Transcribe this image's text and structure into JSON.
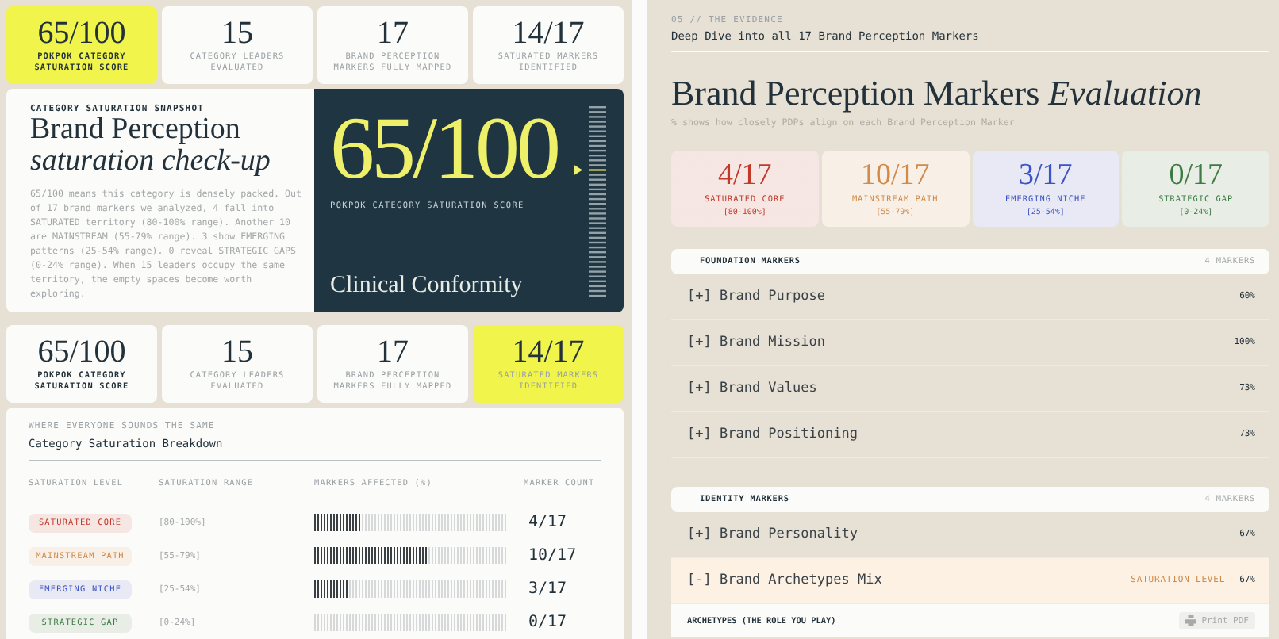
{
  "stats_top": [
    {
      "value": "65/100",
      "label": "POKPOK CATEGORY SATURATION SCORE",
      "highlighted": true,
      "emphasized": true
    },
    {
      "value": "15",
      "label": "CATEGORY LEADERS EVALUATED",
      "highlighted": false,
      "emphasized": false
    },
    {
      "value": "17",
      "label": "BRAND PERCEPTION MARKERS FULLY MAPPED",
      "highlighted": false,
      "emphasized": false
    },
    {
      "value": "14/17",
      "label": "SATURATED MARKERS IDENTIFIED",
      "highlighted": false,
      "emphasized": false
    }
  ],
  "snapshot": {
    "eyebrow": "CATEGORY SATURATION SNAPSHOT",
    "title": "Brand Perception",
    "title_italic": "saturation check-up",
    "body": "65/100 means this category is densely packed. Out of 17 brand markers we analyzed, 4 fall into SATURATED territory (80-100% range). Another 10 are MAINSTREAM (55-79% range). 3 show EMERGING patterns (25-54% range). 0 reveal STRATEGIC GAPS (0-24% range). When 15 leaders occupy the same territory, the empty spaces become worth exploring.",
    "score": "65/100",
    "score_label": "POKPOK CATEGORY SATURATION SCORE",
    "verdict": "Clinical Conformity"
  },
  "stats_bottom": [
    {
      "value": "65/100",
      "label": "POKPOK CATEGORY SATURATION SCORE",
      "highlighted": false,
      "emphasized": true
    },
    {
      "value": "15",
      "label": "CATEGORY LEADERS EVALUATED",
      "highlighted": false,
      "emphasized": false
    },
    {
      "value": "17",
      "label": "BRAND PERCEPTION MARKERS FULLY MAPPED",
      "highlighted": false,
      "emphasized": false
    },
    {
      "value": "14/17",
      "label": "SATURATED MARKERS IDENTIFIED",
      "highlighted": true,
      "emphasized": false
    }
  ],
  "breakdown": {
    "eyebrow": "WHERE EVERYONE SOUNDS THE SAME",
    "title": "Category Saturation Breakdown",
    "columns": [
      "SATURATION LEVEL",
      "SATURATION RANGE",
      "MARKERS AFFECTED (%)",
      "MARKER COUNT"
    ],
    "rows": [
      {
        "level_name": "SATURATED CORE",
        "range": "[80-100%]",
        "level": 0.235,
        "count": "4/17",
        "color": "#c0392b"
      },
      {
        "level_name": "MAINSTREAM PATH",
        "range": "[55-79%]",
        "level": 0.588,
        "count": "10/17",
        "color": "#d08a4a"
      },
      {
        "level_name": "EMERGING NICHE",
        "range": "[25-54%]",
        "level": 0.176,
        "count": "3/17",
        "color": "#3d52c4"
      },
      {
        "level_name": "STRATEGIC GAP",
        "range": "[0-24%]",
        "count": "0/17",
        "color": "#3e7a44"
      }
    ]
  },
  "evidence": {
    "eyebrow": "05 // THE EVIDENCE",
    "subtitle": "Deep Dive into all 17 Brand Perception Markers",
    "title": "Brand Perception Markers",
    "title_italic": "Evaluation",
    "note": "% shows how closely PDPs align on each Brand Perception Marker"
  },
  "summary": [
    {
      "value": "4/17",
      "label": "SATURATED CORE",
      "range": "[80-100%]",
      "color": "#c0392b"
    },
    {
      "value": "10/17",
      "label": "MAINSTREAM PATH",
      "range": "[55-79%]",
      "color": "#d08a4a"
    },
    {
      "value": "3/17",
      "label": "EMERGING NICHE",
      "range": "[25-54%]",
      "color": "#3d52c4"
    },
    {
      "value": "0/17",
      "label": "STRATEGIC GAP",
      "range": "[0-24%]",
      "color": "#3e7a44"
    }
  ],
  "groups": [
    {
      "title": "FOUNDATION MARKERS",
      "count": "4 MARKERS",
      "items": [
        {
          "sign": "[+]",
          "name": "Brand Purpose",
          "value": "60%",
          "expanded": false
        },
        {
          "sign": "[+]",
          "name": "Brand Mission",
          "value": "100%",
          "expanded": false
        },
        {
          "sign": "[+]",
          "name": "Brand Values",
          "value": "73%",
          "expanded": false
        },
        {
          "sign": "[+]",
          "name": "Brand Positioning",
          "value": "73%",
          "expanded": false
        }
      ]
    },
    {
      "title": "IDENTITY MARKERS",
      "count": "4 MARKERS",
      "items": [
        {
          "sign": "[+]",
          "name": "Brand Personality",
          "value": "67%",
          "expanded": false
        },
        {
          "sign": "[-]",
          "name": "Brand Archetypes Mix",
          "value": "67%",
          "expanded": true,
          "status": "SATURATION LEVEL",
          "detail_heading": "ARCHETYPES (THE ROLE YOU PLAY)",
          "button": "Print PDF"
        }
      ]
    }
  ]
}
